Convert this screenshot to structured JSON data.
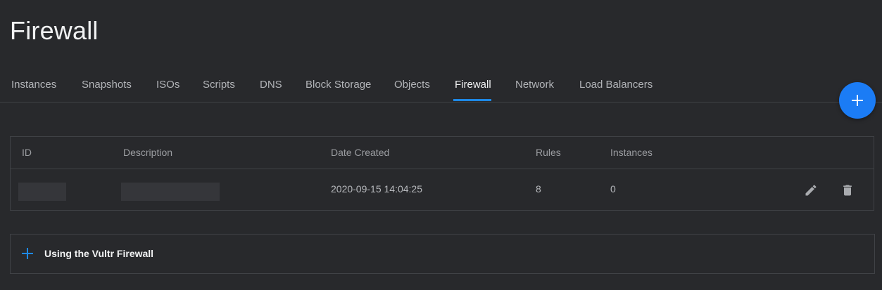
{
  "page": {
    "title": "Firewall"
  },
  "tabs": [
    {
      "label": "Instances"
    },
    {
      "label": "Snapshots"
    },
    {
      "label": "ISOs"
    },
    {
      "label": "Scripts"
    },
    {
      "label": "DNS"
    },
    {
      "label": "Block Storage"
    },
    {
      "label": "Objects"
    },
    {
      "label": "Firewall",
      "active": true
    },
    {
      "label": "Network"
    },
    {
      "label": "Load Balancers"
    }
  ],
  "fab": {
    "icon": "plus-icon"
  },
  "table": {
    "columns": [
      "ID",
      "Description",
      "Date Created",
      "Rules",
      "Instances"
    ],
    "rows": [
      {
        "id": "",
        "description": "",
        "date_created": "2020-09-15 14:04:25",
        "rules": "8",
        "instances": "0",
        "actions": [
          "pencil-icon",
          "trash-icon"
        ]
      }
    ]
  },
  "guide": {
    "icon": "plus-icon",
    "label": "Using the Vultr Firewall"
  },
  "colors": {
    "background": "#28292c",
    "accent": "#1b7cf5",
    "border": "#404246"
  }
}
